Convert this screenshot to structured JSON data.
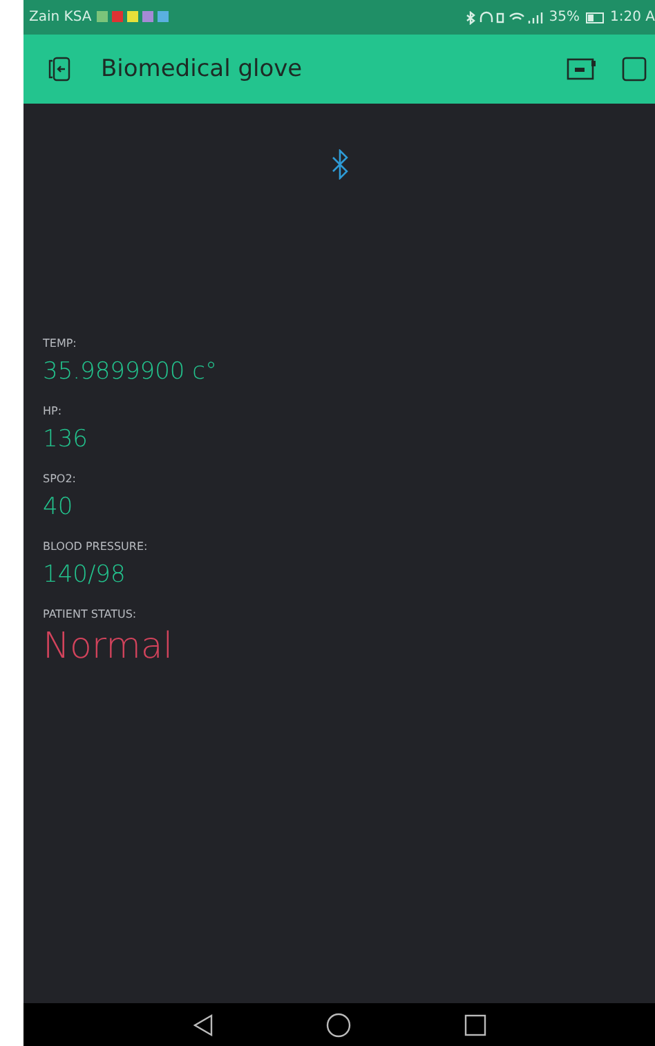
{
  "status_bar": {
    "carrier": "Zain KSA",
    "battery": "35%",
    "time": "1:20 A"
  },
  "app_bar": {
    "title": "Biomedical glove"
  },
  "widgets": [
    {
      "label": "TEMP:",
      "value": "35.9899900 c°",
      "color": "#23c48e",
      "kind": "medium"
    },
    {
      "label": "HP:",
      "value": "136",
      "color": "#23c48e",
      "kind": "medium"
    },
    {
      "label": "SPO2:",
      "value": "40",
      "color": "#23c48e",
      "kind": "medium"
    },
    {
      "label": "BLOOD PRESSURE:",
      "value": "140/98",
      "color": "#23c48e",
      "kind": "medium"
    },
    {
      "label": "PATIENT STATUS:",
      "value": "Normal",
      "color": "#d3435c",
      "kind": "large"
    }
  ]
}
